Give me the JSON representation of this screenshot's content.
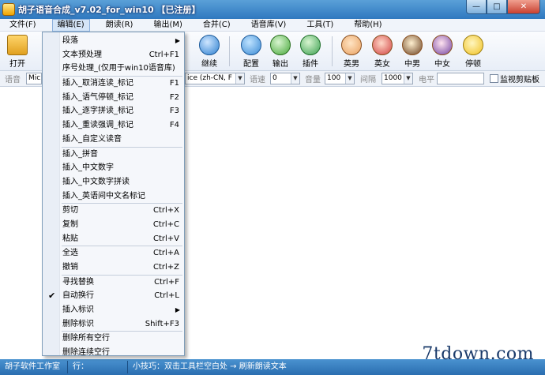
{
  "window": {
    "title": "胡子语音合成_v7.02_for_win10 【已注册】",
    "min_label": "—",
    "max_label": "□",
    "close_label": "✕"
  },
  "menubar": [
    "文件(F)",
    "编辑(E)",
    "朗读(R)",
    "输出(M)",
    "合并(C)",
    "语音库(V)",
    "工具(T)",
    "帮助(H)"
  ],
  "toolbar": {
    "open": "打开",
    "continue": "继续",
    "config": "配置",
    "output": "输出",
    "plugin": "插件",
    "english_male": "英男",
    "english_female": "英女",
    "chinese_male": "中男",
    "chinese_female": "中女",
    "pause": "停顿"
  },
  "options": {
    "voice_label": "语音",
    "voice_value": "Micr",
    "voice_tail": "ice (zh-CN, F",
    "speed_label": "语速",
    "speed_value": "0",
    "volume_label": "音量",
    "volume_value": "100",
    "interval_label": "间隔",
    "interval_value": "1000",
    "level_label": "电平",
    "monitor_clipboard": "监视剪贴板"
  },
  "edit_menu": [
    {
      "label": "段落",
      "shortcut": "",
      "submenu": true
    },
    {
      "label": "文本预处理",
      "shortcut": "Ctrl+F1"
    },
    {
      "label": "序号处理_(仅用于win10语音库)",
      "shortcut": ""
    },
    {
      "sep": true
    },
    {
      "label": "插入_取消连读_标记",
      "shortcut": "F1"
    },
    {
      "label": "插入_语气停顿_标记",
      "shortcut": "F2"
    },
    {
      "label": "插入_逐字拼读_标记",
      "shortcut": "F3"
    },
    {
      "label": "插入_重读强调_标记",
      "shortcut": "F4"
    },
    {
      "label": "插入_自定义读音",
      "shortcut": ""
    },
    {
      "sep": true
    },
    {
      "label": "插入_拼音",
      "shortcut": ""
    },
    {
      "label": "插入_中文数字",
      "shortcut": ""
    },
    {
      "label": "插入_中文数字拼读",
      "shortcut": ""
    },
    {
      "label": "插入_英语间中文名标记",
      "shortcut": ""
    },
    {
      "sep": true
    },
    {
      "label": "剪切",
      "shortcut": "Ctrl+X"
    },
    {
      "label": "复制",
      "shortcut": "Ctrl+C"
    },
    {
      "label": "粘贴",
      "shortcut": "Ctrl+V"
    },
    {
      "sep": true
    },
    {
      "label": "全选",
      "shortcut": "Ctrl+A"
    },
    {
      "label": "撤销",
      "shortcut": "Ctrl+Z"
    },
    {
      "sep": true
    },
    {
      "label": "寻找替换",
      "shortcut": "Ctrl+F"
    },
    {
      "label": "自动换行",
      "shortcut": "Ctrl+L",
      "checked": true
    },
    {
      "label": "插入标识",
      "shortcut": "",
      "submenu": true
    },
    {
      "label": "删除标识",
      "shortcut": "Shift+F3"
    },
    {
      "sep": true
    },
    {
      "label": "删除所有空行",
      "shortcut": ""
    },
    {
      "label": "删除连续空行",
      "shortcut": ""
    }
  ],
  "statusbar": {
    "studio": "胡子软件工作室",
    "line": "行：",
    "tip": "小技巧：双击工具栏空白处 → 刷新朗读文本"
  },
  "watermark": "7tdown.com"
}
